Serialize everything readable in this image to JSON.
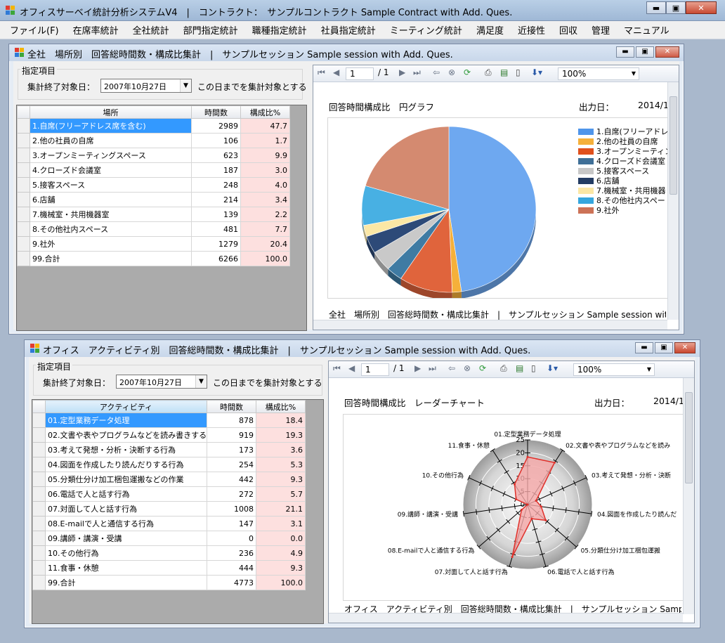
{
  "app": {
    "title": "オフィスサーベイ統計分析システムV4　|　コントラクト：　サンプルコントラクト Sample Contract with Add. Ques.",
    "window_buttons": [
      "▬",
      "▣",
      "✕"
    ]
  },
  "menu": [
    "ファイル(F)",
    "在席率統計",
    "全社統計",
    "部門指定統計",
    "職種指定統計",
    "社員指定統計",
    "ミーティング統計",
    "満足度",
    "近接性",
    "回収",
    "管理",
    "マニュアル"
  ],
  "colors": {
    "pct_cell": "#fde0df",
    "selection": "#3399ff",
    "radar_fill": "#f4a6a6",
    "radar_line": "#e0302a"
  },
  "win1": {
    "title": "全社　場所別　回答総時間数・構成比集計　|　サンプルセッション Sample session with Add. Ques.",
    "group_label": "指定項目",
    "date_label": "集計終了対象日：",
    "date_value": "2007年10月27日",
    "date_note": "この日までを集計対象とする",
    "columns": [
      "場所",
      "時間数",
      "構成比%"
    ],
    "rows": [
      [
        "1.自席(フリーアドレス席を含む)",
        "2989",
        "47.7"
      ],
      [
        "2.他の社員の自席",
        "106",
        "1.7"
      ],
      [
        "3.オープンミーティングスペース",
        "623",
        "9.9"
      ],
      [
        "4.クローズド会議室",
        "187",
        "3.0"
      ],
      [
        "5.接客スペース",
        "248",
        "4.0"
      ],
      [
        "6.店舗",
        "214",
        "3.4"
      ],
      [
        "7.機械室・共用機器室",
        "139",
        "2.2"
      ],
      [
        "8.その他社内スペース",
        "481",
        "7.7"
      ],
      [
        "9.社外",
        "1279",
        "20.4"
      ],
      [
        "99.合計",
        "6266",
        "100.0"
      ]
    ],
    "viewer": {
      "page": "1",
      "of_pages": "/ 1",
      "zoom": "100%",
      "report_title": "回答時間構成比　円グラフ",
      "output_label": "出力日：",
      "output_date": "2014/1",
      "footer": "全社　場所別　回答総時間数・構成比集計　|　サンプルセッション Sample session with Ad",
      "legend": [
        {
          "label": "1.自席(フリーアドレス",
          "color": "#4f95ea"
        },
        {
          "label": "2.他の社員の自席",
          "color": "#f5b03a"
        },
        {
          "label": "3.オープンミーティング",
          "color": "#e0501c"
        },
        {
          "label": "4.クローズド会議室",
          "color": "#3f6f97"
        },
        {
          "label": "5.接客スペース",
          "color": "#c7c7c7"
        },
        {
          "label": "6.店舗",
          "color": "#233c63"
        },
        {
          "label": "7.機械室・共用機器",
          "color": "#fbe7a5"
        },
        {
          "label": "8.その他社内スペー",
          "color": "#35a6de"
        },
        {
          "label": "9.社外",
          "color": "#cc7257"
        }
      ]
    }
  },
  "win2": {
    "title": "オフィス　アクティビティ別　回答総時間数・構成比集計　|　サンプルセッション Sample session with Add. Ques.",
    "group_label": "指定項目",
    "date_label": "集計終了対象日：",
    "date_value": "2007年10月27日",
    "date_note": "この日までを集計対象とする",
    "columns": [
      "アクティビティ",
      "時間数",
      "構成比%"
    ],
    "rows": [
      [
        "01.定型業務データ処理",
        "878",
        "18.4"
      ],
      [
        "02.文書や表やプログラムなどを読み書きする行...",
        "919",
        "19.3"
      ],
      [
        "03.考えて発想・分析・決断する行為",
        "173",
        "3.6"
      ],
      [
        "04.図面を作成したり読んだりする行為",
        "254",
        "5.3"
      ],
      [
        "05.分類仕分け加工梱包運搬などの作業",
        "442",
        "9.3"
      ],
      [
        "06.電話で人と話す行為",
        "272",
        "5.7"
      ],
      [
        "07.対面して人と話す行為",
        "1008",
        "21.1"
      ],
      [
        "08.E-mailで人と通信する行為",
        "147",
        "3.1"
      ],
      [
        "09.講師・講演・受講",
        "0",
        "0.0"
      ],
      [
        "10.その他行為",
        "236",
        "4.9"
      ],
      [
        "11.食事・休憩",
        "444",
        "9.3"
      ],
      [
        "99.合計",
        "4773",
        "100.0"
      ]
    ],
    "viewer": {
      "page": "1",
      "of_pages": "/ 1",
      "zoom": "100%",
      "report_title": "回答時間構成比　レーダーチャート",
      "output_label": "出力日：",
      "output_date": "2014/1",
      "footer": "オフィス　アクティビティ別　回答総時間数・構成比集計　|　サンプルセッション Sample session",
      "radar_labels": [
        "01.定型業務データ処理",
        "02.文書や表やプログラムなどを読み",
        "03.考えて発想・分析・決断",
        "04.図面を作成したり読んだ",
        "05.分類仕分け加工梱包運搬",
        "06.電話で人と話す行為",
        "07.対面して人と話す行為",
        "08.E-mailで人と通信する行為",
        "09.講師・講演・受講",
        "10.その他行為",
        "11.食事・休憩"
      ],
      "radar_ticks": [
        "25",
        "20",
        "15",
        "10",
        "5",
        "0"
      ]
    }
  },
  "chart_data": [
    {
      "type": "pie",
      "title": "回答時間構成比　円グラフ",
      "categories": [
        "1.自席(フリーアドレス席を含む)",
        "2.他の社員の自席",
        "3.オープンミーティングスペース",
        "4.クローズド会議室",
        "5.接客スペース",
        "6.店舗",
        "7.機械室・共用機器室",
        "8.その他社内スペース",
        "9.社外"
      ],
      "values": [
        47.7,
        1.7,
        9.9,
        3.0,
        4.0,
        3.4,
        2.2,
        7.7,
        20.4
      ],
      "colors": [
        "#6ea8f0",
        "#f5b03a",
        "#e0643c",
        "#3f7ba3",
        "#c9c9c9",
        "#2d4a78",
        "#fbe7a5",
        "#48b0e3",
        "#d48a70"
      ]
    },
    {
      "type": "radar",
      "title": "回答時間構成比　レーダーチャート",
      "categories": [
        "01.定型業務データ処理",
        "02.文書や表やプログラムなどを読み書きする行為",
        "03.考えて発想・分析・決断する行為",
        "04.図面を作成したり読んだりする行為",
        "05.分類仕分け加工梱包運搬などの作業",
        "06.電話で人と話す行為",
        "07.対面して人と話す行為",
        "08.E-mailで人と通信する行為",
        "09.講師・講演・受講",
        "10.その他行為",
        "11.食事・休憩"
      ],
      "values": [
        18.4,
        19.3,
        3.6,
        5.3,
        9.3,
        5.7,
        21.1,
        3.1,
        0.0,
        4.9,
        9.3
      ],
      "ylim": [
        0,
        25
      ]
    }
  ]
}
